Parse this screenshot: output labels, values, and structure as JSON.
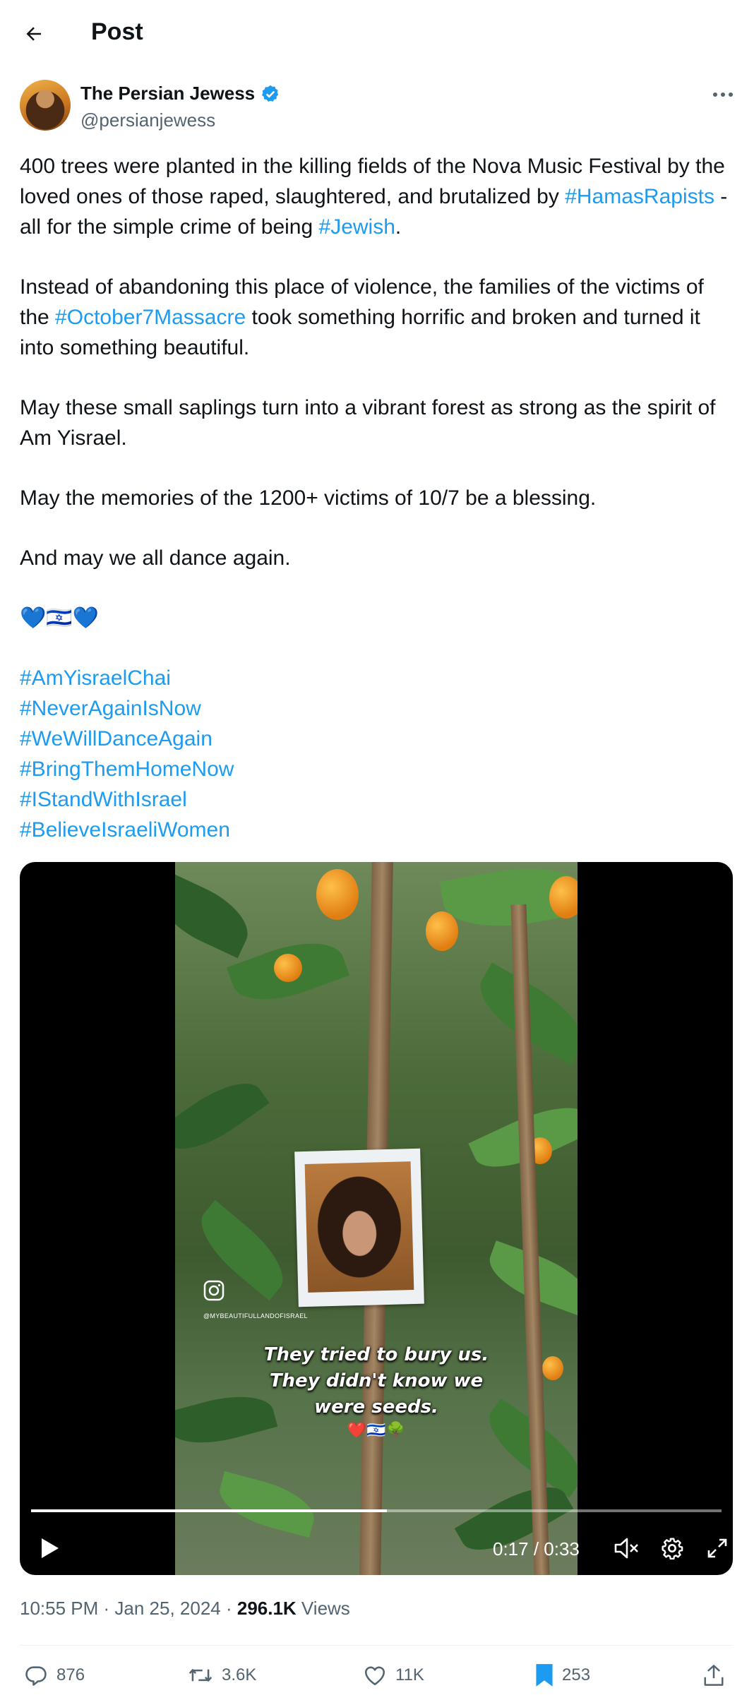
{
  "header": {
    "title": "Post"
  },
  "author": {
    "name": "The Persian Jewess",
    "handle": "@persianjewess"
  },
  "post": {
    "p1": [
      "400 trees were planted in the killing fields of the Nova Music Festival by the loved ones of those raped, slaughtered, and brutalized by ",
      "#HamasRapists",
      " - all for the simple crime of being ",
      "#Jewish",
      "."
    ],
    "p2": [
      "Instead of abandoning this place of violence, the families of the victims of the ",
      "#October7Massacre",
      " took something horrific and broken and turned it into something beautiful."
    ],
    "p3": "May these small saplings turn into a vibrant forest as strong as the spirit of Am Yisrael.",
    "p4": "May the memories of the 1200+ victims of 10/7 be a blessing.",
    "p5": "And may we all dance again.",
    "emojis": "💙🇮🇱💙",
    "hashtags": [
      "#AmYisraelChai",
      "#NeverAgainIsNow",
      "#WeWillDanceAgain",
      "#BringThemHomeNow",
      "#IStandWithIsrael",
      "#BelieveIsraeliWomen"
    ]
  },
  "video": {
    "watermark_handle": "@MYBEAUTIFULLANDOFISRAEL",
    "caption_lines": [
      "They tried to bury us.",
      "They didn't know we",
      "were seeds."
    ],
    "caption_emoji": "❤️🇮🇱🌳",
    "time": "0:17 / 0:33",
    "progress": 0.515
  },
  "meta": {
    "time": "10:55 PM · Jan 25, 2024 · ",
    "views_count": "296.1K",
    "views_label": " Views"
  },
  "actions": {
    "replies": "876",
    "reposts": "3.6K",
    "likes": "11K",
    "bookmarks": "253"
  },
  "colors": {
    "link": "#1d9bf0",
    "text": "#0f1419",
    "secondary": "#536471",
    "bookmark_active": "#1d9bf0"
  }
}
